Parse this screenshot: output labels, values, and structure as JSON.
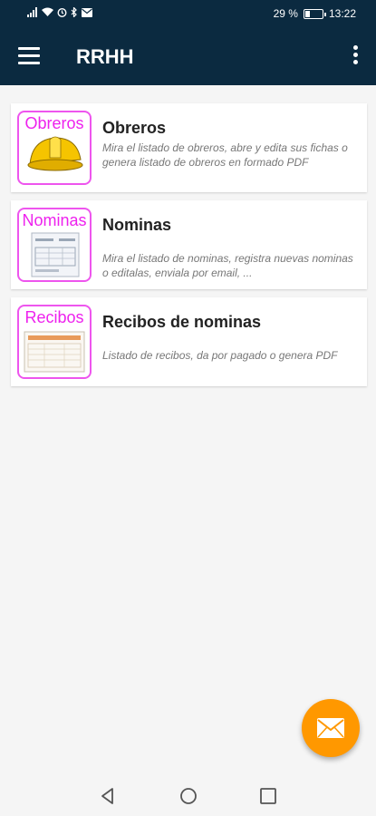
{
  "status_bar": {
    "battery_text": "29 %",
    "battery_level": 0.29,
    "time": "13:22"
  },
  "app_bar": {
    "title": "RRHH",
    "menu_icon": "hamburger-menu-icon",
    "more_icon": "more-vertical-icon"
  },
  "items": [
    {
      "thumb_label": "Obreros",
      "icon": "hard-hat-icon",
      "title": "Obreros",
      "description": "Mira el listado de obreros, abre y edita sus fichas o genera listado de obreros en formado PDF"
    },
    {
      "thumb_label": "Nominas",
      "icon": "payroll-document-icon",
      "title": "Nominas",
      "description": "Mira el listado de nominas, registra nuevas nominas o editalas, enviala por email, ..."
    },
    {
      "thumb_label": "Recibos",
      "icon": "receipt-document-icon",
      "title": "Recibos de nominas",
      "description": "Listado de recibos, da por pagado o genera PDF"
    }
  ],
  "fab": {
    "icon": "mail-icon"
  },
  "colors": {
    "app_bar": "#0b2a40",
    "fab": "#ff9800",
    "thumb_border": "#ee55ee"
  },
  "nav_bar": {
    "back_icon": "back-triangle-icon",
    "home_icon": "home-circle-icon",
    "recents_icon": "recents-square-icon"
  }
}
